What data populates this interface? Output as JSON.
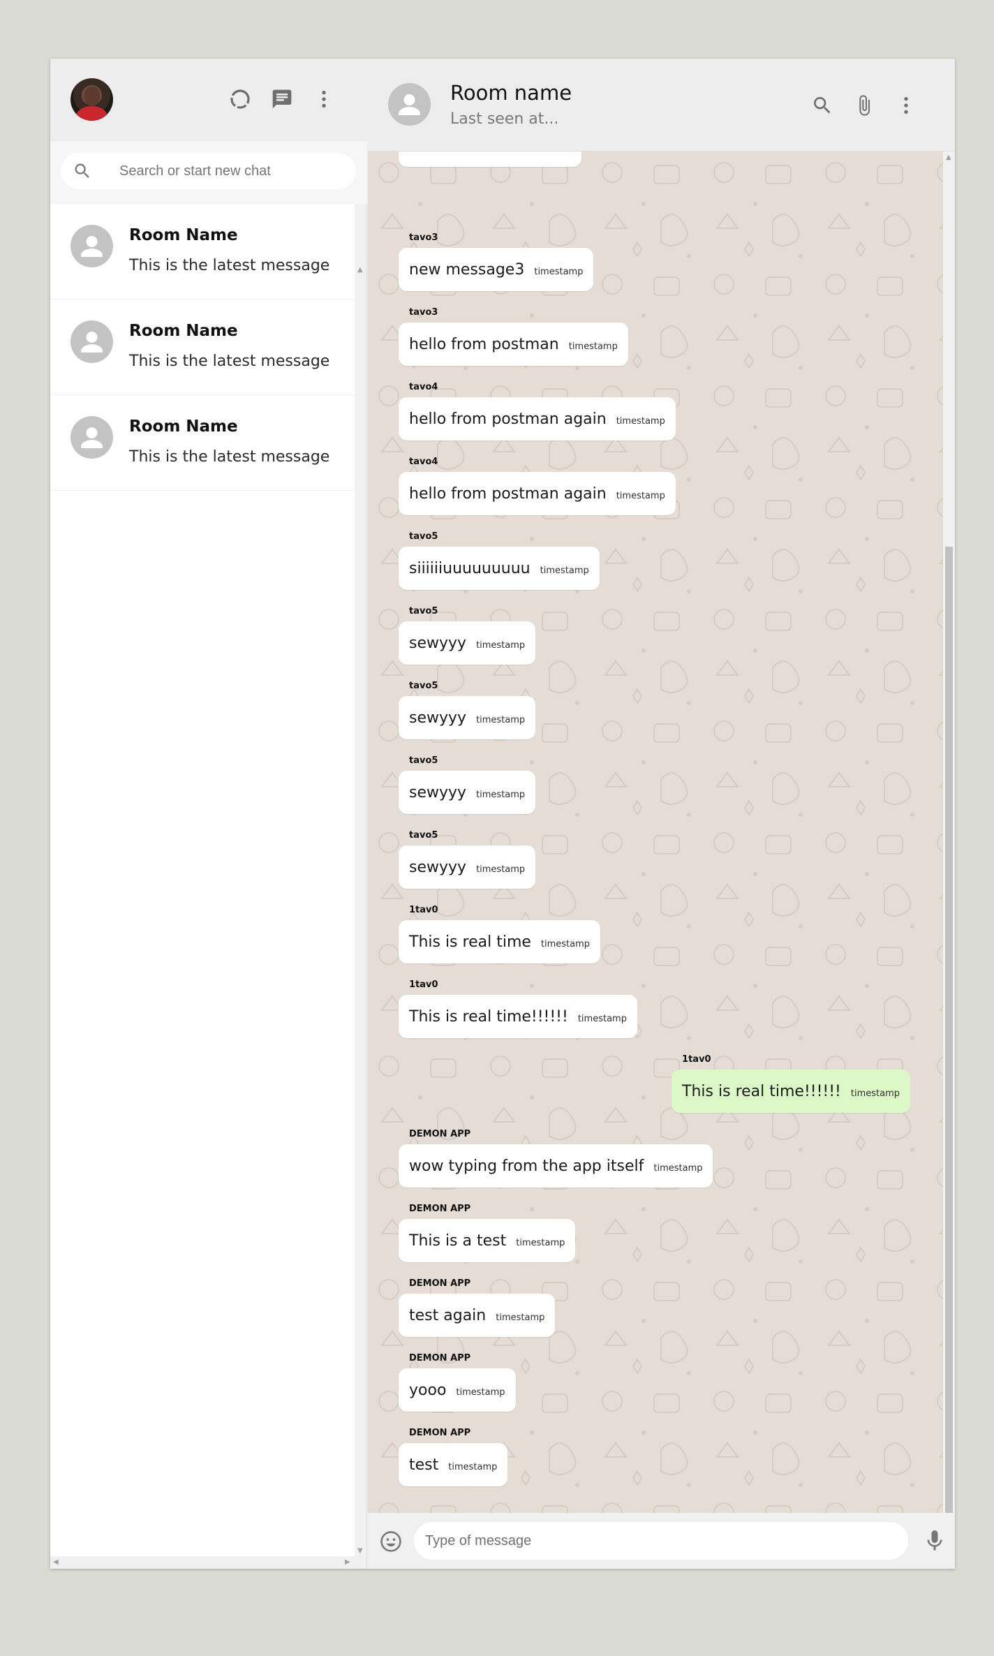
{
  "sidebar": {
    "search": {
      "placeholder": "Search or start new chat"
    },
    "chats": [
      {
        "name": "Room Name",
        "last_message": "This is the latest message"
      },
      {
        "name": "Room Name",
        "last_message": "This is the latest message"
      },
      {
        "name": "Room Name",
        "last_message": "This is the latest message"
      }
    ],
    "icons": [
      "status-icon",
      "chat-icon",
      "more-vert-icon",
      "search-icon"
    ]
  },
  "chat": {
    "header": {
      "title": "Room name",
      "subtitle": "Last seen at...",
      "icons": [
        "search-icon",
        "attach-icon",
        "more-vert-icon"
      ]
    },
    "messages": [
      {
        "name": "tavo3",
        "text": "new message3",
        "timestamp": "timestamp",
        "own": false
      },
      {
        "name": "tavo3",
        "text": "hello from postman",
        "timestamp": "timestamp",
        "own": false
      },
      {
        "name": "tavo4",
        "text": "hello from postman again",
        "timestamp": "timestamp",
        "own": false
      },
      {
        "name": "tavo4",
        "text": "hello from postman again",
        "timestamp": "timestamp",
        "own": false
      },
      {
        "name": "tavo5",
        "text": "siiiiiiuuuuuuuuu",
        "timestamp": "timestamp",
        "own": false
      },
      {
        "name": "tavo5",
        "text": "sewyyy",
        "timestamp": "timestamp",
        "own": false
      },
      {
        "name": "tavo5",
        "text": "sewyyy",
        "timestamp": "timestamp",
        "own": false
      },
      {
        "name": "tavo5",
        "text": "sewyyy",
        "timestamp": "timestamp",
        "own": false
      },
      {
        "name": "tavo5",
        "text": "sewyyy",
        "timestamp": "timestamp",
        "own": false
      },
      {
        "name": "1tav0",
        "text": "This is real time",
        "timestamp": "timestamp",
        "own": false
      },
      {
        "name": "1tav0",
        "text": "This is real time!!!!!!",
        "timestamp": "timestamp",
        "own": false
      },
      {
        "name": "1tav0",
        "text": "This is real time!!!!!!",
        "timestamp": "timestamp",
        "own": true
      },
      {
        "name": "DEMON APP",
        "text": "wow typing from the app itself",
        "timestamp": "timestamp",
        "own": false
      },
      {
        "name": "DEMON APP",
        "text": "This is a test",
        "timestamp": "timestamp",
        "own": false
      },
      {
        "name": "DEMON APP",
        "text": "test again",
        "timestamp": "timestamp",
        "own": false
      },
      {
        "name": "DEMON APP",
        "text": "yooo",
        "timestamp": "timestamp",
        "own": false
      },
      {
        "name": "DEMON APP",
        "text": "test",
        "timestamp": "timestamp",
        "own": false
      }
    ],
    "footer": {
      "placeholder": "Type of message",
      "icons": [
        "emoji-icon",
        "mic-icon"
      ]
    }
  },
  "colors": {
    "chat_background": "#e5ddd5",
    "own_bubble": "#dcf8c6",
    "other_bubble": "#ffffff",
    "header_background": "#ededed",
    "app_background": "#dadbd3"
  }
}
